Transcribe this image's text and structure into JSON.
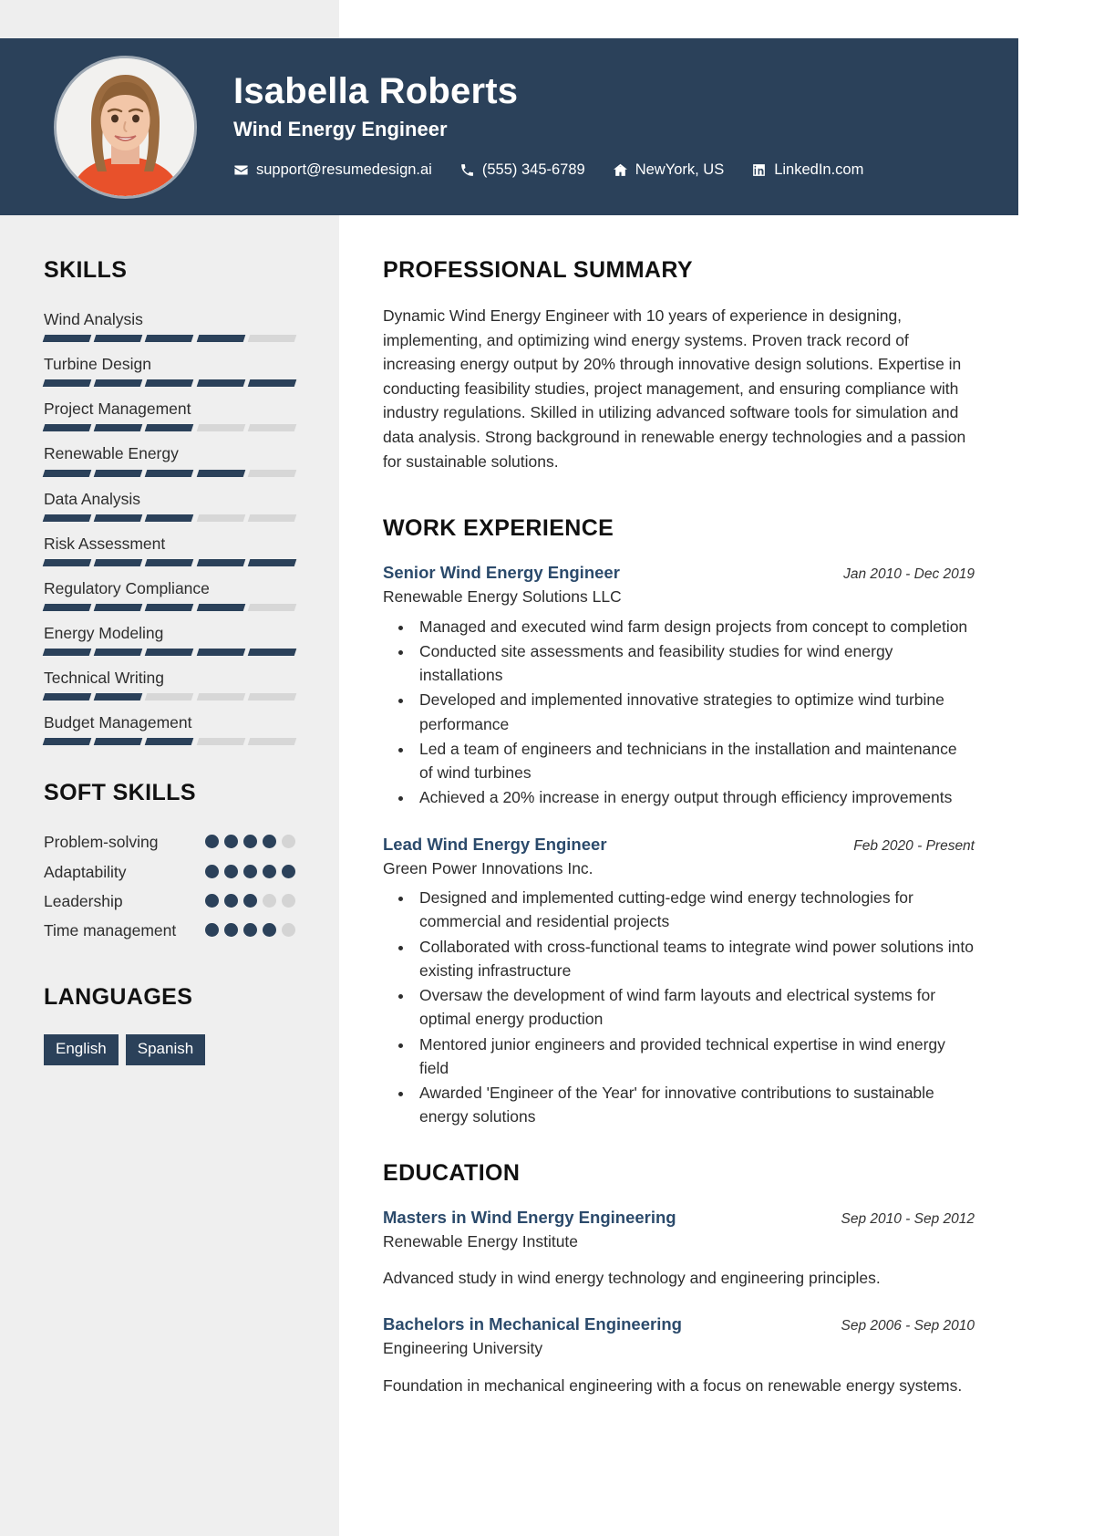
{
  "header": {
    "name": "Isabella Roberts",
    "job_title": "Wind Energy Engineer",
    "avatar_alt": "profile-photo",
    "contacts": [
      {
        "icon": "envelope-icon",
        "text": "support@resumedesign.ai"
      },
      {
        "icon": "phone-icon",
        "text": "(555) 345-6789"
      },
      {
        "icon": "home-icon",
        "text": "NewYork, US"
      },
      {
        "icon": "linkedin-icon",
        "text": "LinkedIn.com"
      }
    ],
    "colors": {
      "background": "#2b415a",
      "text": "#ffffff"
    }
  },
  "sidebar": {
    "skills_heading": "SKILLS",
    "skills": [
      {
        "label": "Wind Analysis",
        "level": 4,
        "max": 5
      },
      {
        "label": "Turbine Design",
        "level": 5,
        "max": 5
      },
      {
        "label": "Project Management",
        "level": 3,
        "max": 5
      },
      {
        "label": "Renewable Energy",
        "level": 4,
        "max": 5
      },
      {
        "label": "Data Analysis",
        "level": 3,
        "max": 5
      },
      {
        "label": "Risk Assessment",
        "level": 5,
        "max": 5
      },
      {
        "label": "Regulatory Compliance",
        "level": 4,
        "max": 5
      },
      {
        "label": "Energy Modeling",
        "level": 5,
        "max": 5
      },
      {
        "label": "Technical Writing",
        "level": 2,
        "max": 5
      },
      {
        "label": "Budget Management",
        "level": 3,
        "max": 5
      }
    ],
    "soft_skills_heading": "SOFT SKILLS",
    "soft_skills": [
      {
        "label": "Problem-solving",
        "level": 4,
        "max": 5
      },
      {
        "label": "Adaptability",
        "level": 5,
        "max": 5
      },
      {
        "label": "Leadership",
        "level": 3,
        "max": 5
      },
      {
        "label": "Time management",
        "level": 4,
        "max": 5
      }
    ],
    "languages_heading": "LANGUAGES",
    "languages": [
      "English",
      "Spanish"
    ],
    "colors": {
      "background": "#efefef",
      "fill": "#2b415a",
      "empty": "#d7d7d7"
    }
  },
  "main": {
    "summary_heading": "PROFESSIONAL SUMMARY",
    "summary_text": "Dynamic Wind Energy Engineer with 10 years of experience in designing, implementing, and optimizing wind energy systems. Proven track record of increasing energy output by 20% through innovative design solutions. Expertise in conducting feasibility studies, project management, and ensuring compliance with industry regulations. Skilled in utilizing advanced software tools for simulation and data analysis. Strong background in renewable energy technologies and a passion for sustainable solutions.",
    "work_heading": "WORK EXPERIENCE",
    "work": [
      {
        "title": "Senior Wind Energy Engineer",
        "date": "Jan 2010 - Dec 2019",
        "org": "Renewable Energy Solutions LLC",
        "bullets": [
          "Managed and executed wind farm design projects from concept to completion",
          "Conducted site assessments and feasibility studies for wind energy installations",
          "Developed and implemented innovative strategies to optimize wind turbine performance",
          "Led a team of engineers and technicians in the installation and maintenance of wind turbines",
          "Achieved a 20% increase in energy output through efficiency improvements"
        ]
      },
      {
        "title": "Lead Wind Energy Engineer",
        "date": "Feb 2020 - Present",
        "org": "Green Power Innovations Inc.",
        "bullets": [
          "Designed and implemented cutting-edge wind energy technologies for commercial and residential projects",
          "Collaborated with cross-functional teams to integrate wind power solutions into existing infrastructure",
          "Oversaw the development of wind farm layouts and electrical systems for optimal energy production",
          "Mentored junior engineers and provided technical expertise in wind energy field",
          "Awarded 'Engineer of the Year' for innovative contributions to sustainable energy solutions"
        ]
      }
    ],
    "education_heading": "EDUCATION",
    "education": [
      {
        "title": "Masters in Wind Energy Engineering",
        "date": "Sep 2010 - Sep 2012",
        "org": "Renewable Energy Institute",
        "desc": "Advanced study in wind energy technology and engineering principles."
      },
      {
        "title": "Bachelors in Mechanical Engineering",
        "date": "Sep 2006 - Sep 2010",
        "org": "Engineering University",
        "desc": "Foundation in mechanical engineering with a focus on renewable energy systems."
      }
    ],
    "colors": {
      "entry_title": "#2b4a6b",
      "text": "#2d2d2d"
    }
  }
}
